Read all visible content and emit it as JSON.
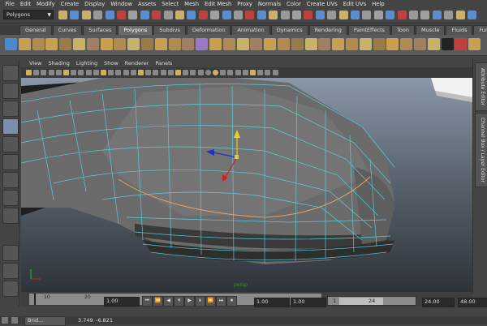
{
  "menubar": [
    "File",
    "Edit",
    "Modify",
    "Create",
    "Display",
    "Window",
    "Assets",
    "Select",
    "Mesh",
    "Edit Mesh",
    "Proxy",
    "Normals",
    "Color",
    "Create UVs",
    "Edit UVs",
    "Help"
  ],
  "status": {
    "mode": "Polygons"
  },
  "shelf_tabs": [
    "General",
    "Curves",
    "Surfaces",
    "Polygons",
    "Subdivs",
    "Deformation",
    "Animation",
    "Dynamics",
    "Rendering",
    "PaintEffects",
    "Toon",
    "Muscle",
    "Fluids",
    "Fur"
  ],
  "shelf_active": "Polygons",
  "panel_menu": [
    "View",
    "Shading",
    "Lighting",
    "Show",
    "Renderer",
    "Panels"
  ],
  "right_tabs": [
    "Attribute Editor",
    "Channel Box / Layer Editor"
  ],
  "timeline": {
    "ticks": [
      "10",
      "20"
    ],
    "current": "1.00"
  },
  "range": {
    "start": "1.00",
    "start2": "1.00",
    "current": "1",
    "end_field": "24",
    "end": "24.00",
    "max": "48.00"
  },
  "taskbar": {
    "item": "Brid...",
    "coords": [
      "3.749",
      "-6.821"
    ]
  },
  "viewport": {
    "label": "persp"
  },
  "colors": {
    "accent": "#8a8a8a",
    "wire": "#5ad6e6",
    "selection": "#e8a268"
  }
}
